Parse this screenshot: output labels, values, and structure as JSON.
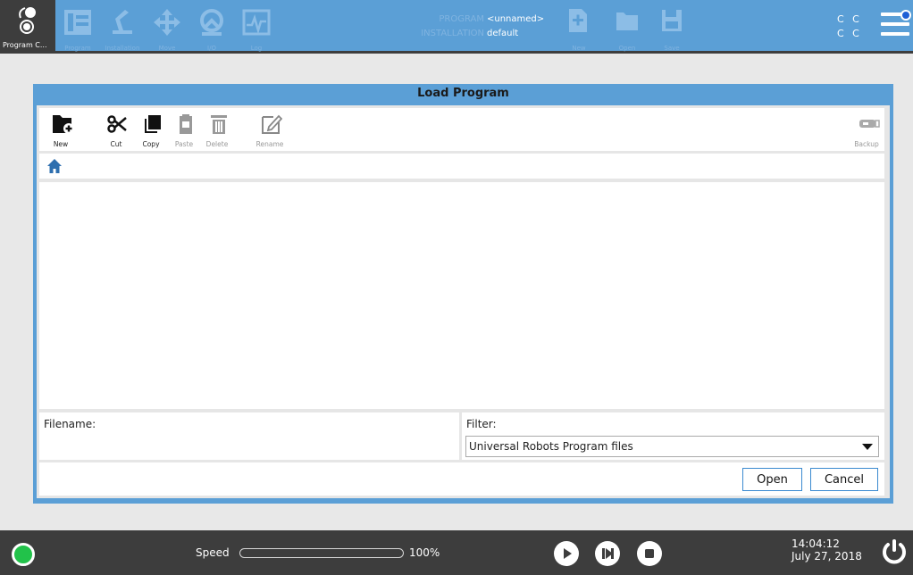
{
  "header": {
    "home_label": "Program C...",
    "nav": [
      {
        "label": "Program",
        "icon": "program-tree-icon"
      },
      {
        "label": "Installation",
        "icon": "installation-icon"
      },
      {
        "label": "Move",
        "icon": "move-icon"
      },
      {
        "label": "I/O",
        "icon": "io-icon"
      },
      {
        "label": "Log",
        "icon": "log-icon"
      }
    ],
    "program_key": "PROGRAM",
    "program_value": "<unnamed>",
    "installation_key": "INSTALLATION",
    "installation_value": "default",
    "file_actions": [
      {
        "label": "New",
        "icon": "new-file-icon"
      },
      {
        "label": "Open",
        "icon": "open-folder-icon"
      },
      {
        "label": "Save",
        "icon": "save-icon"
      }
    ],
    "cc_top": "C C",
    "cc_bottom": "C C"
  },
  "dialog": {
    "title": "Load Program",
    "toolbar": {
      "new": "New",
      "cut": "Cut",
      "copy": "Copy",
      "paste": "Paste",
      "delete": "Delete",
      "rename": "Rename",
      "backup": "Backup"
    },
    "filename_label": "Filename:",
    "filter_label": "Filter:",
    "filter_value": "Universal Robots Program files",
    "open_button": "Open",
    "cancel_button": "Cancel"
  },
  "footer": {
    "speed_label": "Speed",
    "speed_value": "100%",
    "speed_fraction": 1.0,
    "time": "14:04:12",
    "date": "July 27, 2018"
  },
  "colors": {
    "accent": "#5b9fd6",
    "dark_bar": "#3d3d3d",
    "status_green": "#22c24a",
    "button_border": "#3b8ad0"
  }
}
